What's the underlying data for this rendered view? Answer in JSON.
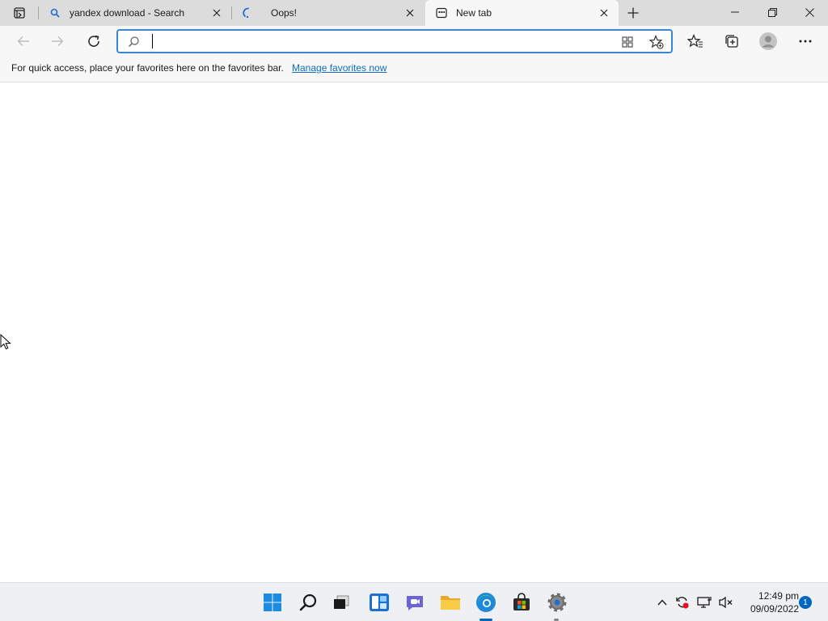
{
  "tabs": [
    {
      "title": "yandex download - Search",
      "icon": "search-icon"
    },
    {
      "title": "Oops!",
      "icon": "loading-spinner-icon"
    },
    {
      "title": "New tab",
      "icon": "new-tab-page-icon",
      "active": true
    }
  ],
  "address_bar": {
    "value": "",
    "placeholder": ""
  },
  "favorites_bar": {
    "message": "For quick access, place your favorites here on the favorites bar.",
    "link": "Manage favorites now"
  },
  "taskbar": {
    "apps": [
      "start-icon",
      "search-icon",
      "task-view-icon",
      "widgets-icon",
      "teams-chat-icon",
      "file-explorer-icon",
      "edge-icon",
      "store-icon",
      "settings-icon"
    ],
    "clock_time": "12:49 pm",
    "clock_date": "09/09/2022",
    "notification_count": "1"
  },
  "colors": {
    "accent": "#0067c0",
    "link": "#0f6cbd",
    "address_border": "#3a86d4"
  }
}
